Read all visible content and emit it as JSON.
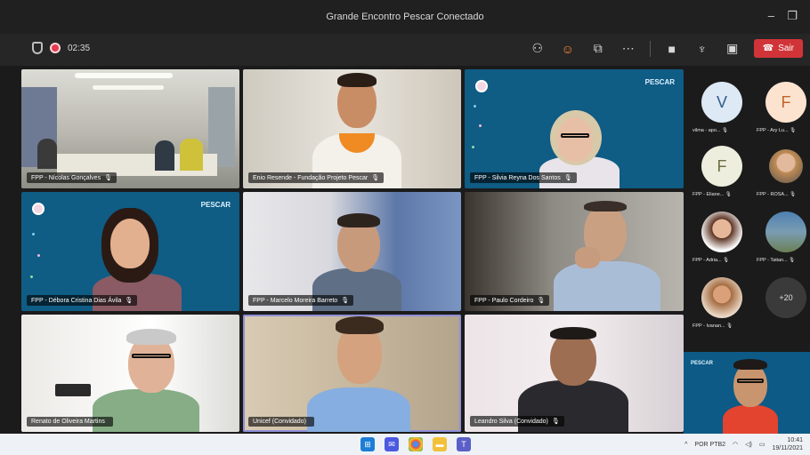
{
  "window": {
    "title": "Grande Encontro Pescar Conectado",
    "minimize": "–",
    "restore": "❐"
  },
  "toolbar": {
    "timer": "02:35",
    "icons": [
      "participants-icon",
      "reactions-icon",
      "share-icon",
      "more-icon",
      "camera-icon",
      "mic-icon",
      "share-screen-icon"
    ],
    "leave_label": "Sair"
  },
  "tiles": [
    {
      "name": "FPP - Nícolas Gonçalves",
      "mic": "🎙"
    },
    {
      "name": "Enio Resende - Fundação Projeto Pescar",
      "mic": "🎙"
    },
    {
      "name": "FPP - Silvia Reyna Dos Santos",
      "mic": "🎙"
    },
    {
      "name": "FPP - Débora Cristina Dias Ávila",
      "mic": "🎙"
    },
    {
      "name": "FPP - Marcelo Moreira Barreto",
      "mic": "🎙"
    },
    {
      "name": "FPP - Paulo Cordeiro",
      "mic": "🎙"
    },
    {
      "name": "Renato de Oliveira Martins",
      "mic": ""
    },
    {
      "name": "Unicef (Convidado)",
      "mic": ""
    },
    {
      "name": "Leandro Silva (Convidado)",
      "mic": "🎙"
    }
  ],
  "tile_logo": "PESCAR",
  "sidebar": [
    {
      "initial": "V",
      "label": "vilma - apo... 🎙"
    },
    {
      "initial": "F",
      "label": "FPP - Ary Lu... 🎙"
    },
    {
      "initial": "F",
      "label": "FPP - Eliane... 🎙"
    },
    {
      "initial": "",
      "label": "FPP - ROSA... 🎙"
    },
    {
      "initial": "",
      "label": "FPP - Adria... 🎙"
    },
    {
      "initial": "",
      "label": "FPP - Tatian... 🎙"
    },
    {
      "initial": "",
      "label": "FPP - Ivanan... 🎙"
    },
    {
      "initial": "+20",
      "label": ""
    }
  ],
  "taskbar": {
    "icons": [
      "windows-start-icon",
      "chat-icon",
      "chrome-icon",
      "file-explorer-icon",
      "teams-icon"
    ],
    "tray_lang": "POR PTB2",
    "tray_time": "10:41",
    "tray_date": "19/11/2021"
  }
}
